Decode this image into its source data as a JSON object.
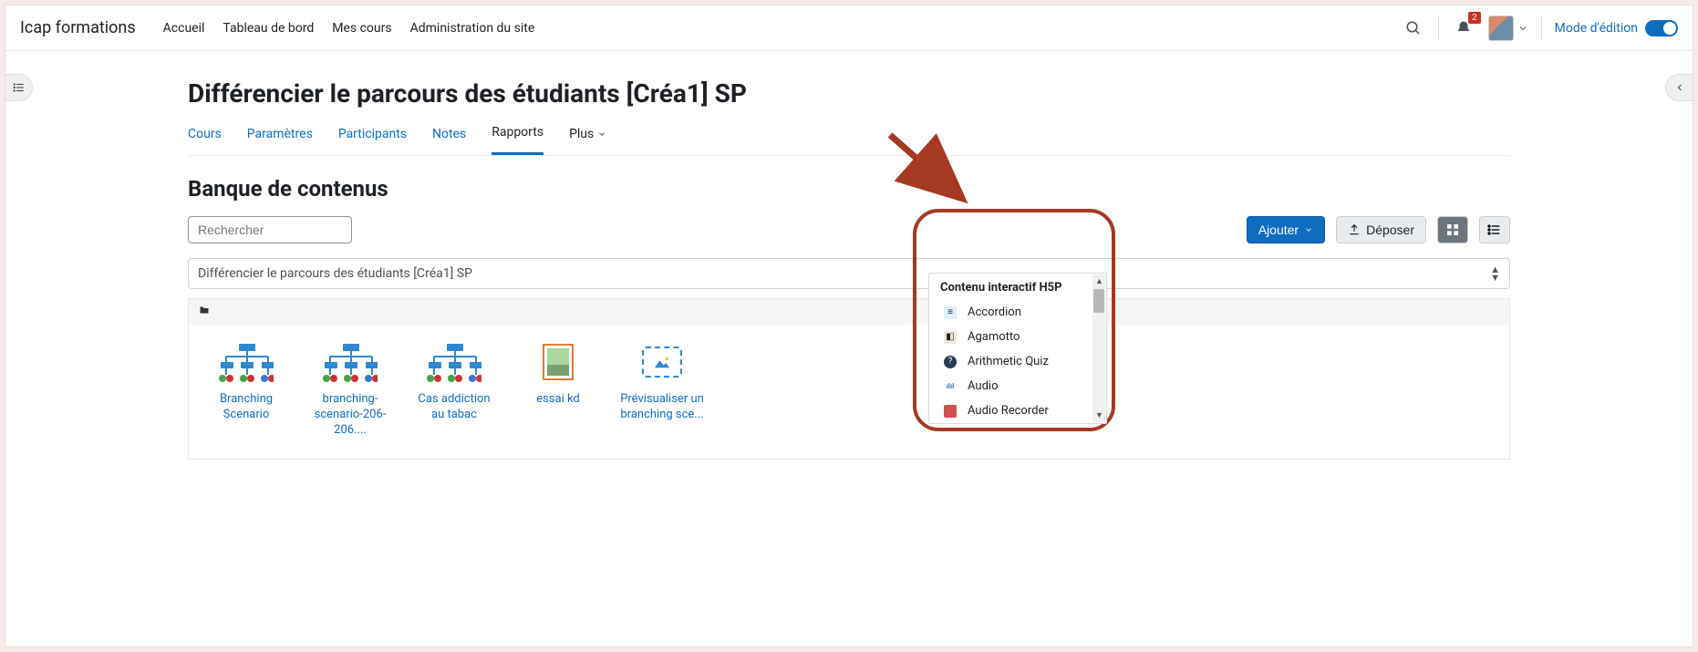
{
  "brand": "Icap formations",
  "topnav": {
    "home": "Accueil",
    "dashboard": "Tableau de bord",
    "mycourses": "Mes cours",
    "siteadmin": "Administration du site"
  },
  "notifications_count": "2",
  "edit_mode_label": "Mode d'édition",
  "page_title": "Différencier le parcours des étudiants [Créa1] SP",
  "tabs": {
    "course": "Cours",
    "params": "Paramètres",
    "participants": "Participants",
    "grades": "Notes",
    "reports": "Rapports",
    "more": "Plus"
  },
  "section_title": "Banque de contenus",
  "search_placeholder": "Rechercher",
  "add_button": "Ajouter",
  "upload_button": "Déposer",
  "context_selected": "Différencier le parcours des étudiants [Créa1] SP",
  "cards": [
    {
      "label": "Branching Scenario"
    },
    {
      "label": "branching-scenario-206-206...."
    },
    {
      "label": "Cas addiction au tabac"
    },
    {
      "label": "essai kd"
    },
    {
      "label": "Prévisualiser un branching sce..."
    }
  ],
  "dropdown": {
    "header": "Contenu interactif H5P",
    "items": [
      {
        "label": "Accordion",
        "icon_color": "#4aa0e0"
      },
      {
        "label": "Agamotto",
        "icon_color": "#c0a070"
      },
      {
        "label": "Arithmetic Quiz",
        "icon_color": "#2b3a55"
      },
      {
        "label": "Audio",
        "icon_color": "#3b79c4"
      },
      {
        "label": "Audio Recorder",
        "icon_color": "#d05050"
      }
    ]
  }
}
